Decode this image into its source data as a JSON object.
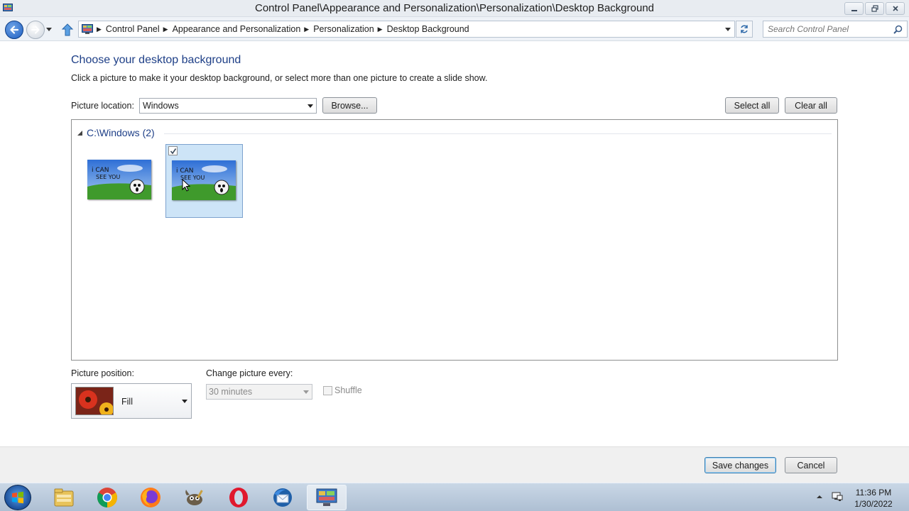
{
  "window": {
    "title": "Control Panel\\Appearance and Personalization\\Personalization\\Desktop Background",
    "icon": "control-panel-icon",
    "controls": [
      "minimize-icon",
      "restore-icon",
      "close-icon"
    ]
  },
  "address_bar": {
    "breadcrumbs": [
      "Control Panel",
      "Appearance and Personalization",
      "Personalization",
      "Desktop Background"
    ],
    "search_placeholder": "Search Control Panel"
  },
  "main": {
    "heading": "Choose your desktop background",
    "description": "Click a picture to make it your desktop background, or select more than one picture to create a slide show.",
    "picture_location": {
      "label": "Picture location:",
      "value": "Windows"
    },
    "browse_label": "Browse...",
    "select_all_label": "Select all",
    "clear_all_label": "Clear all",
    "gallery": {
      "group_title": "C:\\Windows (2)",
      "items": [
        {
          "selected": false,
          "checked": false
        },
        {
          "selected": true,
          "checked": true
        }
      ]
    },
    "picture_position": {
      "label": "Picture position:",
      "value": "Fill"
    },
    "change_picture": {
      "label": "Change picture every:",
      "value": "30 minutes"
    },
    "shuffle": {
      "label": "Shuffle",
      "checked": false
    }
  },
  "footer": {
    "save_label": "Save changes",
    "cancel_label": "Cancel"
  },
  "taskbar": {
    "apps": [
      "file-explorer-icon",
      "chrome-icon",
      "firefox-icon",
      "gimp-icon",
      "opera-icon",
      "thunderbird-icon",
      "control-panel-icon"
    ],
    "active_app": "control-panel-icon",
    "time": "11:36 PM",
    "date": "1/30/2022"
  },
  "colors": {
    "heading": "#1e3f87",
    "selection": "#cde4f7",
    "taskbar": "#b9c9dc"
  }
}
